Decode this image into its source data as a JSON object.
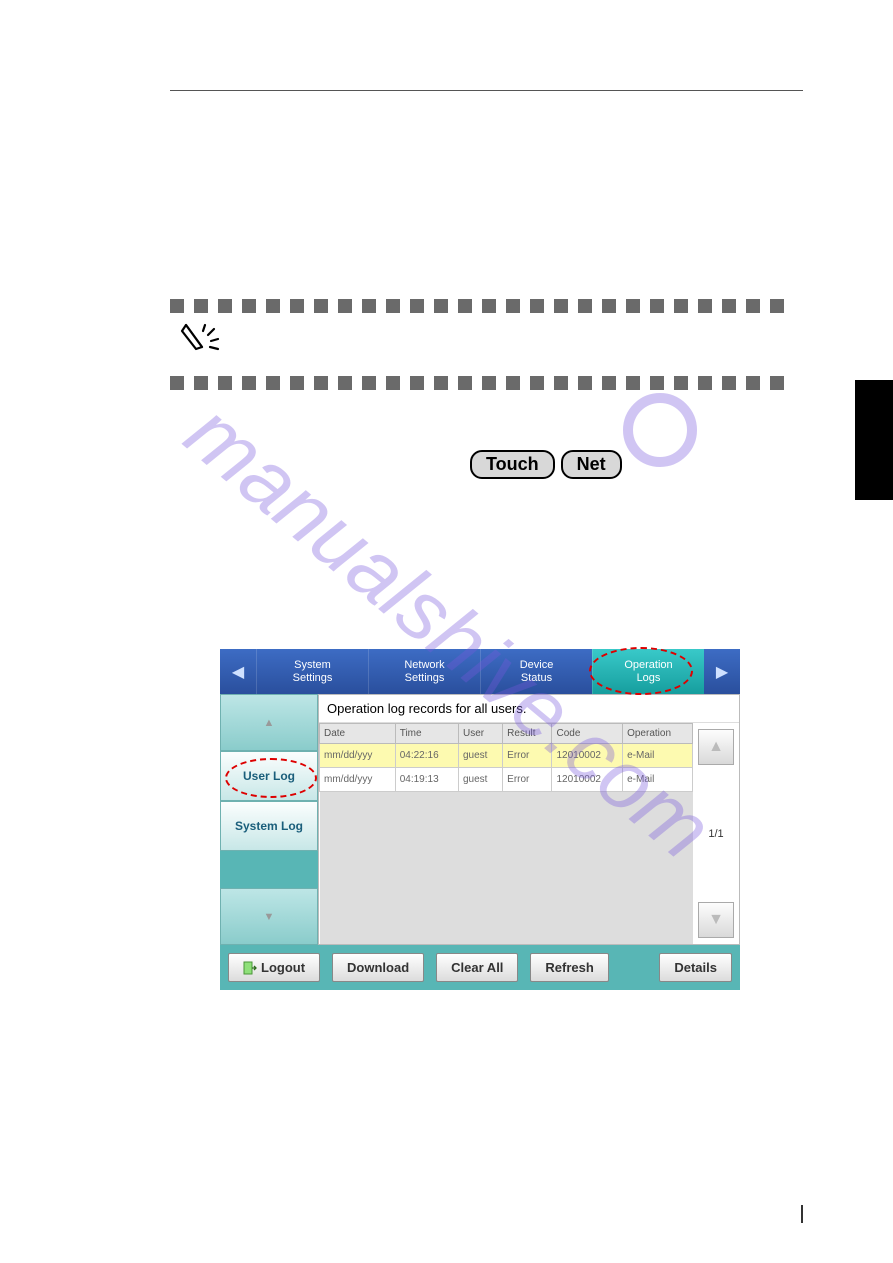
{
  "badges": {
    "touch": "Touch",
    "net": "Net"
  },
  "ui": {
    "nav": {
      "items": [
        {
          "l1": "System",
          "l2": "Settings"
        },
        {
          "l1": "Network",
          "l2": "Settings"
        },
        {
          "l1": "Device",
          "l2": "Status"
        },
        {
          "l1": "Operation",
          "l2": "Logs"
        }
      ]
    },
    "side": {
      "user_log": "User Log",
      "system_log": "System Log"
    },
    "title": "Operation log records for all users.",
    "table": {
      "headers": [
        "Date",
        "Time",
        "User",
        "Result",
        "Code",
        "Operation"
      ],
      "rows": [
        [
          "mm/dd/yyy",
          "04:22:16",
          "guest",
          "Error",
          "12010002",
          "e-Mail"
        ],
        [
          "mm/dd/yyy",
          "04:19:13",
          "guest",
          "Error",
          "12010002",
          "e-Mail"
        ]
      ]
    },
    "page_indicator": "1/1",
    "buttons": {
      "logout": "Logout",
      "download": "Download",
      "clear": "Clear All",
      "refresh": "Refresh",
      "details": "Details"
    }
  }
}
